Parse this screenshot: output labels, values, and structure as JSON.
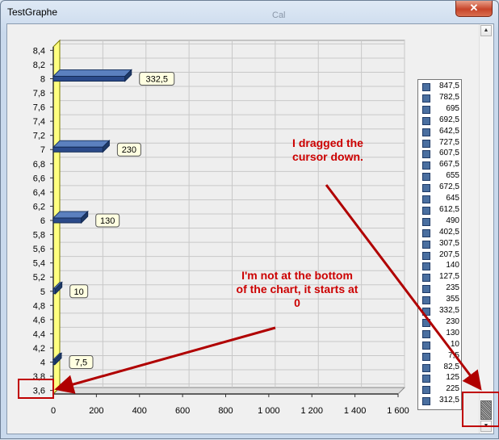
{
  "window": {
    "title": "TestGraphe",
    "close_label": "✕",
    "background_text": "Cal"
  },
  "scrollbar": {
    "up_icon": "up-arrow",
    "down_icon": "down-arrow"
  },
  "chart_data": {
    "type": "bar",
    "orientation": "horizontal",
    "y_ticks": [
      "3,6",
      "3,8",
      "4",
      "4,2",
      "4,4",
      "4,6",
      "4,8",
      "5",
      "5,2",
      "5,4",
      "5,6",
      "5,8",
      "6",
      "6,2",
      "6,4",
      "6,6",
      "6,8",
      "7",
      "7,2",
      "7,4",
      "7,6",
      "7,8",
      "8",
      "8,2",
      "8,4"
    ],
    "x_ticks": [
      "0",
      "200",
      "400",
      "600",
      "800",
      "1 000",
      "1 200",
      "1 400",
      "1 600"
    ],
    "xlim": [
      0,
      1600
    ],
    "ylim": [
      3.55,
      8.45
    ],
    "grid": true,
    "legend_position": "right",
    "bars": [
      {
        "y": 8,
        "value": 332.5,
        "label": "332,5"
      },
      {
        "y": 7,
        "value": 230,
        "label": "230"
      },
      {
        "y": 6,
        "value": 130,
        "label": "130"
      },
      {
        "y": 5,
        "value": 10,
        "label": "10"
      },
      {
        "y": 4,
        "value": 7.5,
        "label": "7,5"
      }
    ],
    "legend": [
      "847,5",
      "782,5",
      "695",
      "692,5",
      "642,5",
      "727,5",
      "607,5",
      "667,5",
      "655",
      "672,5",
      "645",
      "612,5",
      "490",
      "402,5",
      "307,5",
      "207,5",
      "140",
      "127,5",
      "235",
      "355",
      "332,5",
      "230",
      "130",
      "10",
      "7,5",
      "82,5",
      "125",
      "225",
      "312,5"
    ]
  },
  "annotations": {
    "dragged_line1": "I dragged the",
    "dragged_line2": "cursor down.",
    "bottom_line1": "I'm not at the bottom",
    "bottom_line2": "of the chart, it starts at",
    "bottom_line3": "0"
  },
  "colors": {
    "bar": "#2b4a8a",
    "axis_wall": "#ffff80",
    "annotation": "#cc0000"
  }
}
